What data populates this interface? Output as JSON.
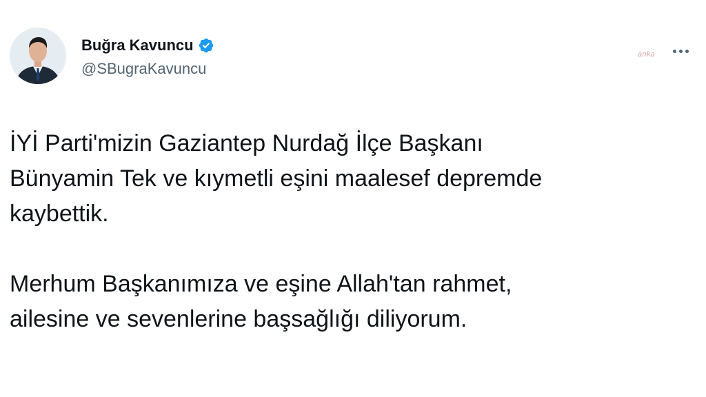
{
  "author": {
    "display_name": "Buğra Kavuncu",
    "handle": "@SBugraKavuncu",
    "avatar_icon": "profile-photo-avatar",
    "verified_icon": "verified-badge-icon",
    "verified_color": "#1d9bf0"
  },
  "watermark": "anka",
  "tweet": {
    "paragraph1": [
      "İYİ Parti'mizin Gaziantep Nurdağ İlçe Başkanı",
      "Bünyamin Tek ve kıymetli eşini maalesef depremde",
      "kaybettik."
    ],
    "paragraph2": [
      "Merhum Başkanımıza ve eşine Allah'tan rahmet,",
      "ailesine ve sevenlerine başsağlığı diliyorum."
    ]
  },
  "colors": {
    "text_primary": "#0f1419",
    "text_secondary": "#536471",
    "background": "#ffffff"
  }
}
